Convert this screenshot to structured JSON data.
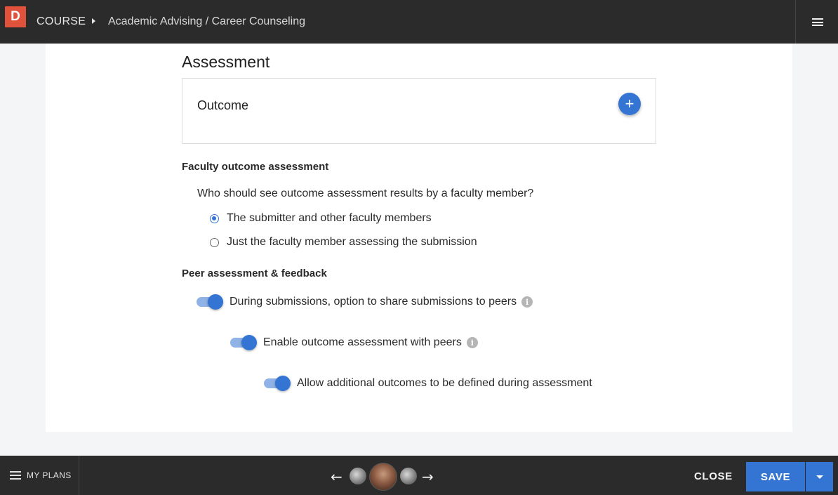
{
  "header": {
    "logo_letter": "D",
    "breadcrumb_root": "COURSE",
    "breadcrumb_title": "Academic Advising / Career Counseling",
    "menu_icon": "hamburger-menu-icon"
  },
  "main": {
    "section_title": "Assessment",
    "outcome": {
      "label": "Outcome",
      "add_icon": "+"
    },
    "faculty": {
      "heading": "Faculty outcome assessment",
      "question": "Who should see outcome assessment results by a faculty member?",
      "options": [
        {
          "label": "The submitter and other faculty members",
          "selected": true
        },
        {
          "label": "Just the faculty member assessing the submission",
          "selected": false
        }
      ]
    },
    "peer": {
      "heading": "Peer assessment & feedback",
      "toggles": [
        {
          "label": "During submissions, option to share submissions to peers",
          "on": true,
          "info": true
        },
        {
          "label": "Enable outcome assessment with peers",
          "on": true,
          "info": true
        },
        {
          "label": "Allow additional outcomes to be defined during assessment",
          "on": true,
          "info": false
        }
      ],
      "info_glyph": "i"
    }
  },
  "footer": {
    "my_plans_label": "MY PLANS",
    "prev_arrow": "←",
    "next_arrow": "→",
    "close_label": "CLOSE",
    "save_label": "SAVE"
  },
  "colors": {
    "topbar": "#2b2b2b",
    "accent": "#3475d4",
    "logo": "#e1523d",
    "page_background": "#f4f5f7"
  }
}
